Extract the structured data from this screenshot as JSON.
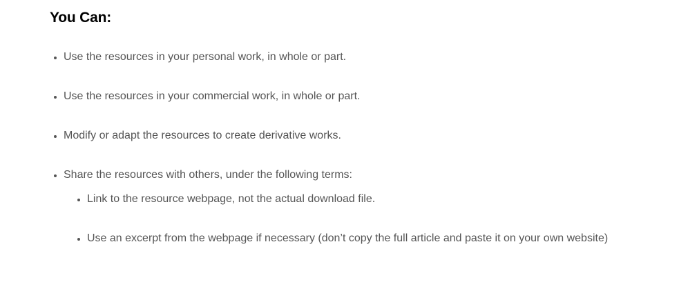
{
  "section": {
    "heading": "You Can:",
    "items": [
      {
        "text": "Use the resources in your personal work, in whole or part."
      },
      {
        "text": "Use the resources in your commercial work, in whole or part."
      },
      {
        "text": "Modify or adapt the resources to create derivative works."
      },
      {
        "text": "Share the resources with others, under the following terms:"
      }
    ],
    "sub_items": [
      {
        "text": "Link to the resource webpage, not the actual download file."
      },
      {
        "text": "Use an excerpt from the webpage if necessary (don’t copy the full article and paste it on your own website)"
      }
    ]
  }
}
